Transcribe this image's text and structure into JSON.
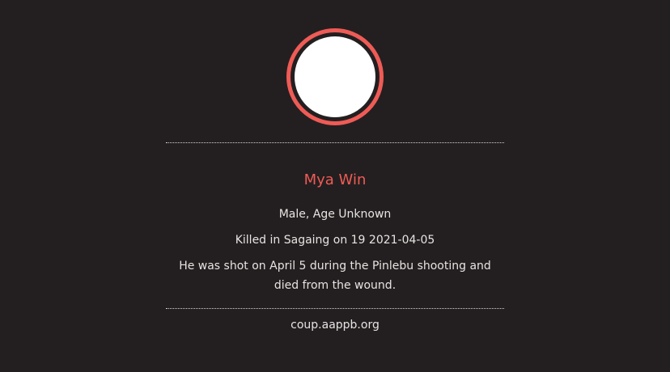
{
  "profile": {
    "name": "Mya Win",
    "gender_age": "Male, Age Unknown",
    "death_info": "Killed in Sagaing on 19 2021-04-05",
    "description": "He was shot on April 5 during the Pinlebu shooting and died from the wound.",
    "source": "coup.aappb.org"
  },
  "colors": {
    "background": "#231f20",
    "accent": "#ef5b56",
    "text": "#e6e4e2"
  }
}
